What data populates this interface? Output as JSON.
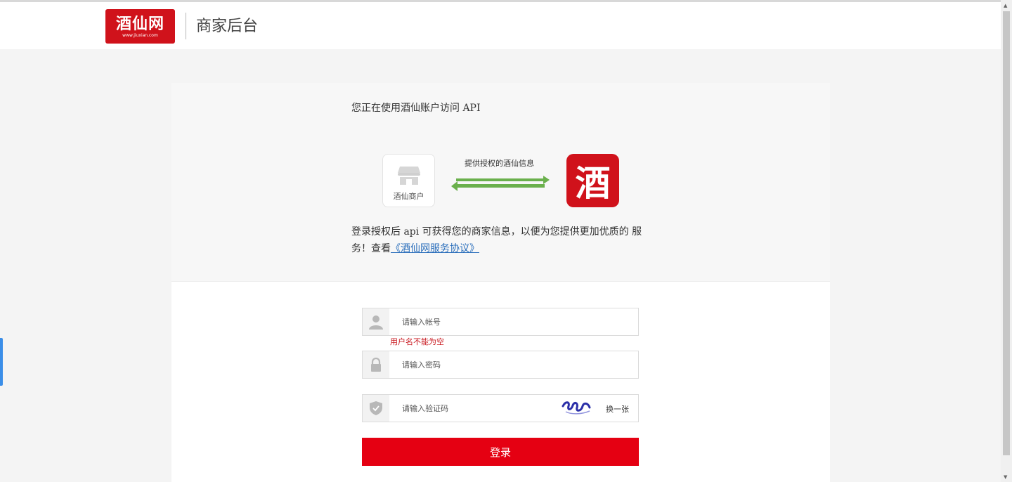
{
  "header": {
    "logo_text": "酒仙网",
    "logo_sub": "www.jiuxian.com",
    "title": "商家后台"
  },
  "auth": {
    "title": "您正在使用酒仙账户访问 API",
    "merchant_label": "酒仙商户",
    "flow_label": "提供授权的酒仙信息",
    "app_glyph": "酒",
    "desc_prefix": "登录授权后 api 可获得您的商家信息，以便为您提供更加优质的 服务！查看",
    "agreement_link": "《酒仙网服务协议》"
  },
  "form": {
    "username_placeholder": "请输入帐号",
    "username_error": "用户名不能为空",
    "password_placeholder": "请输入密码",
    "captcha_placeholder": "请输入验证码",
    "captcha_refresh": "换一张",
    "login_label": "登录"
  },
  "colors": {
    "brand_red": "#d0121b",
    "button_red": "#e50012",
    "error_red": "#c8161d",
    "link_blue": "#2a6ebb",
    "arrow_green": "#6ab04c"
  },
  "icons": {
    "shop": "shop-icon",
    "user": "user-icon",
    "lock": "lock-icon",
    "shield": "shield-icon"
  }
}
